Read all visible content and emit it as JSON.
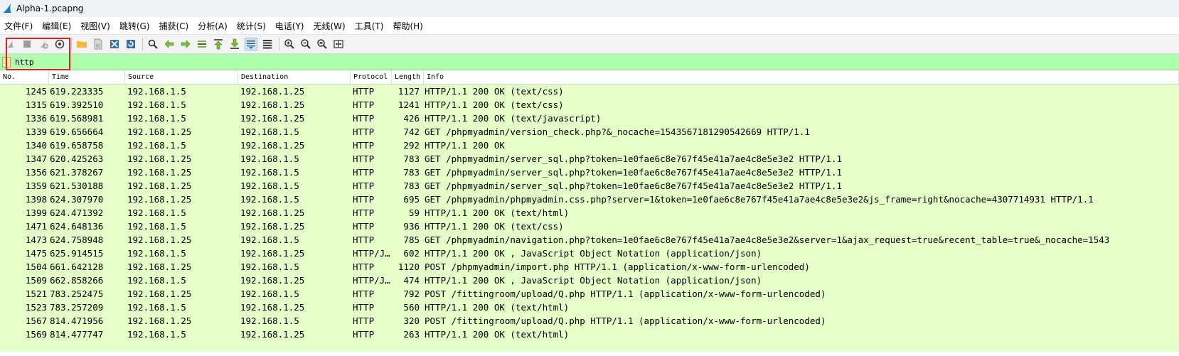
{
  "window": {
    "title": "Alpha-1.pcapng"
  },
  "menu": [
    {
      "label": "文件(F)"
    },
    {
      "label": "编辑(E)"
    },
    {
      "label": "视图(V)"
    },
    {
      "label": "跳转(G)"
    },
    {
      "label": "捕获(C)"
    },
    {
      "label": "分析(A)"
    },
    {
      "label": "统计(S)"
    },
    {
      "label": "电话(Y)"
    },
    {
      "label": "无线(W)"
    },
    {
      "label": "工具(T)"
    },
    {
      "label": "帮助(H)"
    }
  ],
  "filter": {
    "value": "http"
  },
  "columns": [
    "No.",
    "Time",
    "Source",
    "Destination",
    "Protocol",
    "Length",
    "Info"
  ],
  "packets": [
    {
      "no": "1245",
      "time": "619.223335",
      "src": "192.168.1.5",
      "dst": "192.168.1.25",
      "proto": "HTTP",
      "len": "1127",
      "info": "HTTP/1.1 200 OK  (text/css)"
    },
    {
      "no": "1315",
      "time": "619.392510",
      "src": "192.168.1.5",
      "dst": "192.168.1.25",
      "proto": "HTTP",
      "len": "1241",
      "info": "HTTP/1.1 200 OK  (text/css)"
    },
    {
      "no": "1336",
      "time": "619.568981",
      "src": "192.168.1.5",
      "dst": "192.168.1.25",
      "proto": "HTTP",
      "len": "426",
      "info": "HTTP/1.1 200 OK  (text/javascript)"
    },
    {
      "no": "1339",
      "time": "619.656664",
      "src": "192.168.1.25",
      "dst": "192.168.1.5",
      "proto": "HTTP",
      "len": "742",
      "info": "GET /phpmyadmin/version_check.php?&_nocache=1543567181290542669 HTTP/1.1"
    },
    {
      "no": "1340",
      "time": "619.658758",
      "src": "192.168.1.5",
      "dst": "192.168.1.25",
      "proto": "HTTP",
      "len": "292",
      "info": "HTTP/1.1 200 OK"
    },
    {
      "no": "1347",
      "time": "620.425263",
      "src": "192.168.1.25",
      "dst": "192.168.1.5",
      "proto": "HTTP",
      "len": "783",
      "info": "GET /phpmyadmin/server_sql.php?token=1e0fae6c8e767f45e41a7ae4c8e5e3e2 HTTP/1.1"
    },
    {
      "no": "1356",
      "time": "621.378267",
      "src": "192.168.1.25",
      "dst": "192.168.1.5",
      "proto": "HTTP",
      "len": "783",
      "info": "GET /phpmyadmin/server_sql.php?token=1e0fae6c8e767f45e41a7ae4c8e5e3e2 HTTP/1.1"
    },
    {
      "no": "1359",
      "time": "621.530188",
      "src": "192.168.1.25",
      "dst": "192.168.1.5",
      "proto": "HTTP",
      "len": "783",
      "info": "GET /phpmyadmin/server_sql.php?token=1e0fae6c8e767f45e41a7ae4c8e5e3e2 HTTP/1.1"
    },
    {
      "no": "1398",
      "time": "624.307970",
      "src": "192.168.1.25",
      "dst": "192.168.1.5",
      "proto": "HTTP",
      "len": "695",
      "info": "GET /phpmyadmin/phpmyadmin.css.php?server=1&token=1e0fae6c8e767f45e41a7ae4c8e5e3e2&js_frame=right&nocache=4307714931 HTTP/1.1"
    },
    {
      "no": "1399",
      "time": "624.471392",
      "src": "192.168.1.5",
      "dst": "192.168.1.25",
      "proto": "HTTP",
      "len": "59",
      "info": "HTTP/1.1 200 OK  (text/html)"
    },
    {
      "no": "1471",
      "time": "624.648136",
      "src": "192.168.1.5",
      "dst": "192.168.1.25",
      "proto": "HTTP",
      "len": "936",
      "info": "HTTP/1.1 200 OK  (text/css)"
    },
    {
      "no": "1473",
      "time": "624.758948",
      "src": "192.168.1.25",
      "dst": "192.168.1.5",
      "proto": "HTTP",
      "len": "785",
      "info": "GET /phpmyadmin/navigation.php?token=1e0fae6c8e767f45e41a7ae4c8e5e3e2&server=1&ajax_request=true&recent_table=true&_nocache=1543"
    },
    {
      "no": "1475",
      "time": "625.914515",
      "src": "192.168.1.5",
      "dst": "192.168.1.25",
      "proto": "HTTP/J…",
      "len": "602",
      "info": "HTTP/1.1 200 OK , JavaScript Object Notation (application/json)"
    },
    {
      "no": "1504",
      "time": "661.642128",
      "src": "192.168.1.25",
      "dst": "192.168.1.5",
      "proto": "HTTP",
      "len": "1120",
      "info": "POST /phpmyadmin/import.php HTTP/1.1  (application/x-www-form-urlencoded)"
    },
    {
      "no": "1509",
      "time": "662.858266",
      "src": "192.168.1.5",
      "dst": "192.168.1.25",
      "proto": "HTTP/J…",
      "len": "474",
      "info": "HTTP/1.1 200 OK , JavaScript Object Notation (application/json)"
    },
    {
      "no": "1521",
      "time": "783.252475",
      "src": "192.168.1.25",
      "dst": "192.168.1.5",
      "proto": "HTTP",
      "len": "792",
      "info": "POST /fittingroom/upload/Q.php HTTP/1.1  (application/x-www-form-urlencoded)"
    },
    {
      "no": "1523",
      "time": "783.257209",
      "src": "192.168.1.5",
      "dst": "192.168.1.25",
      "proto": "HTTP",
      "len": "560",
      "info": "HTTP/1.1 200 OK  (text/html)"
    },
    {
      "no": "1567",
      "time": "814.471956",
      "src": "192.168.1.25",
      "dst": "192.168.1.5",
      "proto": "HTTP",
      "len": "320",
      "info": "POST /fittingroom/upload/Q.php HTTP/1.1  (application/x-www-form-urlencoded)"
    },
    {
      "no": "1569",
      "time": "814.477747",
      "src": "192.168.1.5",
      "dst": "192.168.1.25",
      "proto": "HTTP",
      "len": "263",
      "info": "HTTP/1.1 200 OK  (text/html)"
    }
  ],
  "icons": [
    "wireshark-fin-icon",
    "start-capture-icon",
    "stop-capture-icon",
    "restart-capture-icon",
    "capture-options-icon",
    "open-file-icon",
    "save-file-icon",
    "close-file-icon",
    "reload-file-icon",
    "find-packet-icon",
    "go-back-icon",
    "go-forward-icon",
    "go-to-packet-icon",
    "first-packet-icon",
    "last-packet-icon",
    "autoscroll-icon",
    "colorize-icon",
    "zoom-in-icon",
    "zoom-out-icon",
    "normal-size-icon",
    "resize-columns-icon",
    "filter-bookmark-icon"
  ],
  "colors": {
    "filter_valid_bg": "#afffaf",
    "http_row_bg": "#e4ffc7",
    "annotation_box": "#e02020"
  }
}
